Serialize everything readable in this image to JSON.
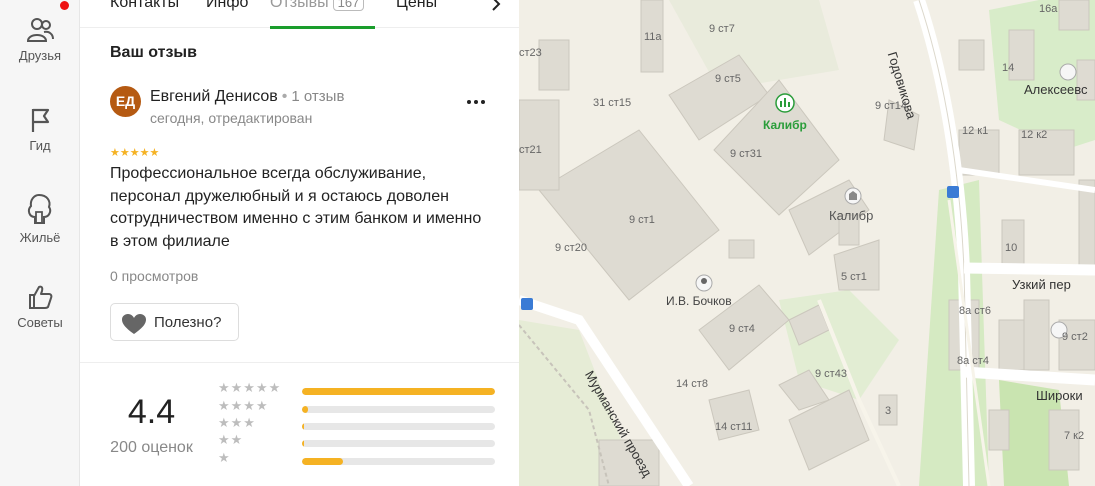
{
  "rail": {
    "items": [
      {
        "label": "Друзья"
      },
      {
        "label": "Гид"
      },
      {
        "label": "Жильё"
      },
      {
        "label": "Советы"
      }
    ]
  },
  "tabs": {
    "items": [
      "Контакты",
      "Инфо",
      "Отзывы",
      "Цены"
    ],
    "active_badge": "167"
  },
  "review": {
    "heading": "Ваш отзыв",
    "avatar_initials": "ЕД",
    "author": "Евгений Денисов",
    "separator": "•",
    "author_reviews": "1 отзыв",
    "date": "сегодня, отредактирован",
    "stars": "★★★★★",
    "text": "Профессиональное всегда обслуживание, персонал дружелюбный и я остаюсь доволен сотрудничеством именно с этим банком и именно в этом филиале",
    "views": "0 просмотров",
    "useful_label": "Полезно?"
  },
  "rating": {
    "value": "4.4",
    "count": "200 оценок",
    "distribution": [
      {
        "stars": "★★★★★",
        "fraction": 1.0
      },
      {
        "stars": "★★★★",
        "fraction": 0.03
      },
      {
        "stars": "★★★",
        "fraction": 0.01
      },
      {
        "stars": "★★",
        "fraction": 0.01
      },
      {
        "stars": "★",
        "fraction": 0.21
      }
    ]
  },
  "map": {
    "poi": [
      "Калибр",
      "Калибр",
      "И.В. Бочков"
    ],
    "streets": [
      "Годовикова",
      "Узкий пер",
      "Мурманский проезд",
      "Алексеевс",
      "Широки"
    ],
    "buildings": [
      "11а",
      "9 ст7",
      "ст23",
      "9 ст5",
      "31 ст15",
      "9 ст14",
      "9 ст31",
      "ст21",
      "9 ст1",
      "9 ст20",
      "5 ст1",
      "9 ст4",
      "14 ст8",
      "9 ст43",
      "14 ст11",
      "12 к1",
      "12 к2",
      "14",
      "16а",
      "10",
      "8а ст6",
      "8а ст4",
      "9 ст2",
      "7 к2",
      "3"
    ]
  },
  "colors": {
    "accent_green": "#1a9d2c",
    "star_yellow": "#f5b223",
    "avatar_brown": "#b55a12",
    "notification_red": "#e11"
  }
}
